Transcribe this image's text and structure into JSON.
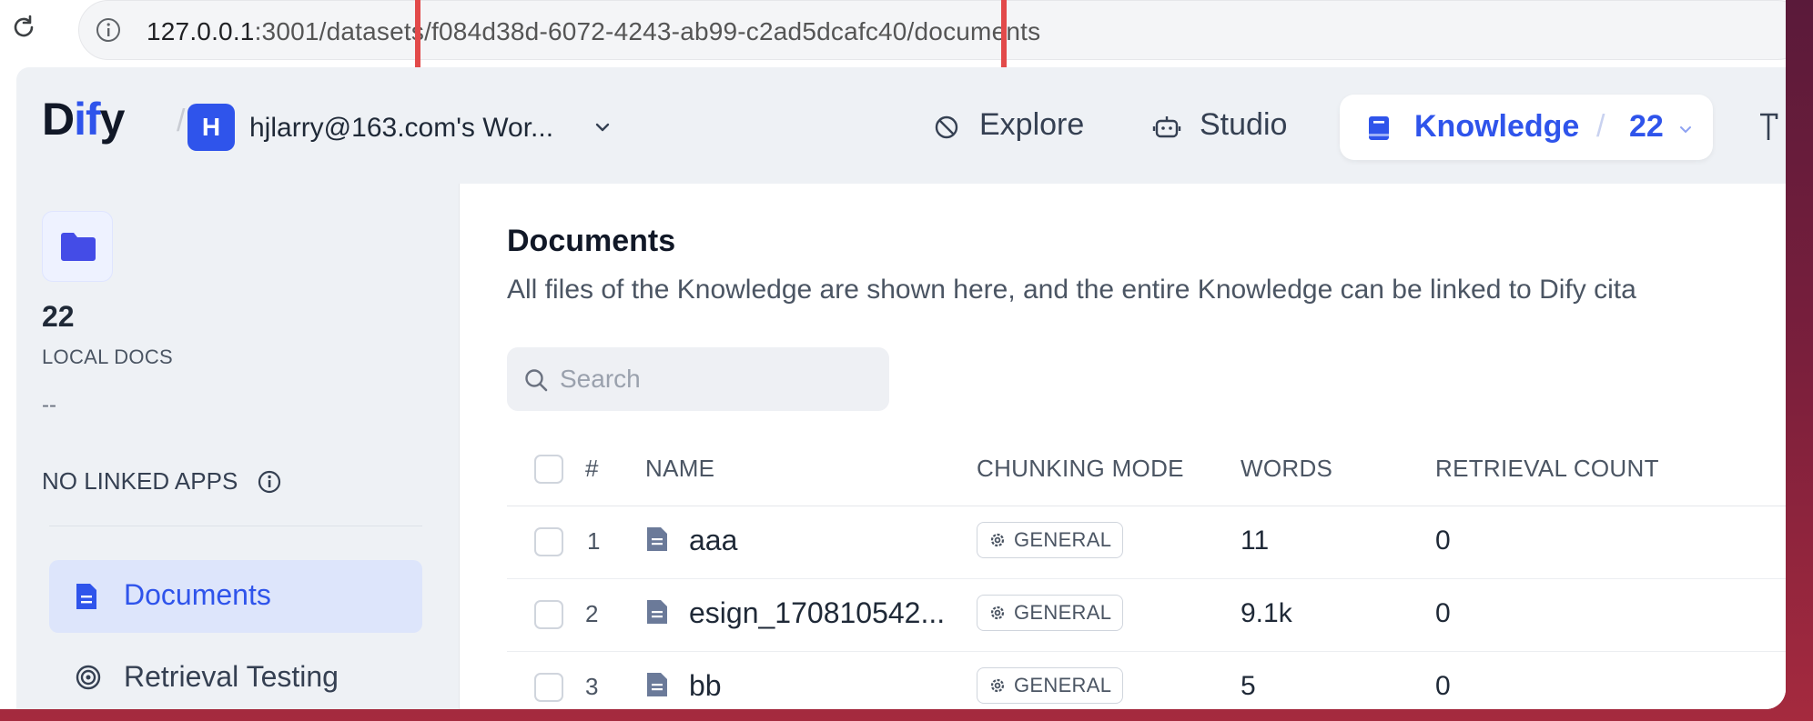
{
  "browser": {
    "url_host": "127.0.0.1",
    "url_rest": ":3001/datasets/f084d38d-6072-4243-ab99-c2ad5dcafc40/documents"
  },
  "header": {
    "logo_prefix": "D",
    "logo_highlight": "if",
    "logo_suffix": "y",
    "separator": "/",
    "workspace_initial": "H",
    "workspace_name": "hjlarry@163.com's Wor...",
    "nav": {
      "explore": "Explore",
      "studio": "Studio",
      "knowledge": "Knowledge",
      "knowledge_separator": "/",
      "knowledge_count": "22"
    }
  },
  "sidebar": {
    "dataset_name": "22",
    "dataset_type": "LOCAL DOCS",
    "dataset_description": "--",
    "linked_apps": "NO LINKED APPS",
    "items": [
      {
        "label": "Documents"
      },
      {
        "label": "Retrieval Testing"
      }
    ]
  },
  "main": {
    "title": "Documents",
    "subtitle": "All files of the Knowledge are shown here, and the entire Knowledge can be linked to Dify cita",
    "search_placeholder": "Search",
    "columns": {
      "index": "#",
      "name": "NAME",
      "chunking_mode": "CHUNKING MODE",
      "words": "WORDS",
      "retrieval_count": "RETRIEVAL COUNT"
    },
    "rows": [
      {
        "index": "1",
        "name": "aaa",
        "mode": "GENERAL",
        "words": "11",
        "retrieval": "0"
      },
      {
        "index": "2",
        "name": "esign_170810542...",
        "mode": "GENERAL",
        "words": "9.1k",
        "retrieval": "0"
      },
      {
        "index": "3",
        "name": "bb",
        "mode": "GENERAL",
        "words": "5",
        "retrieval": "0"
      }
    ]
  },
  "colors": {
    "accent": "#2f54eb",
    "highlight_box": "#e24a4a"
  }
}
